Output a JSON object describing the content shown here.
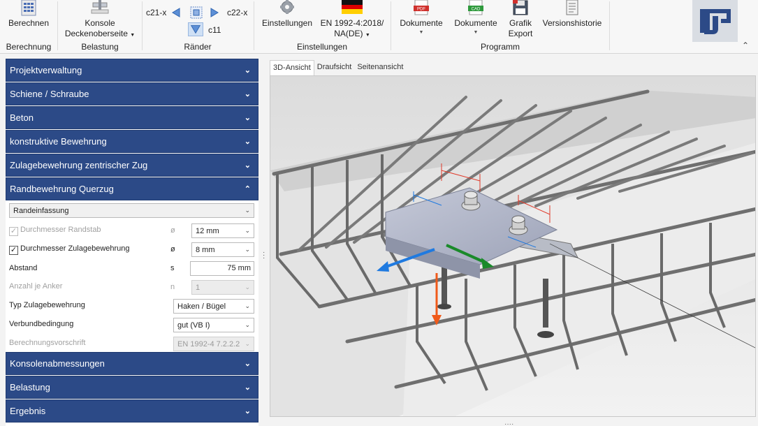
{
  "ribbon": {
    "berechnung": {
      "button": "Berechnen",
      "group": "Berechnung"
    },
    "belastung": {
      "button_line1": "Konsole",
      "button_line2": "Deckenoberseite",
      "group": "Belastung"
    },
    "raender": {
      "c21x": "c21-x",
      "c22x": "c22-x",
      "c11": "c11",
      "group": "Ränder"
    },
    "einstellungen": {
      "settings": "Einstellungen",
      "norm_line1": "EN 1992-4:2018/",
      "norm_line2": "NA(DE)",
      "group": "Einstellungen"
    },
    "programm": {
      "doc_pdf": "Dokumente",
      "doc_cad": "Dokumente",
      "grafik_line1": "Grafik",
      "grafik_line2": "Export",
      "versions": "Versionshistorie",
      "group": "Programm",
      "pdf_tag": "PDF",
      "cad_tag": "CAD"
    }
  },
  "accordion": {
    "projekt": "Projektverwaltung",
    "schiene": "Schiene / Schraube",
    "beton": "Beton",
    "konstruktiv": "konstruktive Bewehrung",
    "zulage_zug": "Zulagebewehrung zentrischer Zug",
    "rand": "Randbewehrung Querzug",
    "konsole": "Konsolenabmessungen",
    "belastung": "Belastung",
    "ergebnis": "Ergebnis"
  },
  "rand_form": {
    "type_select": "Randeinfassung",
    "randstab_label": "Durchmesser Randstab",
    "randstab_sym": "ø",
    "randstab_value": "12 mm",
    "zulage_label": "Durchmesser Zulagebewehrung",
    "zulage_sym": "ø",
    "zulage_value": "8 mm",
    "abstand_label": "Abstand",
    "abstand_sym": "s",
    "abstand_value": "75 mm",
    "anker_label": "Anzahl je Anker",
    "anker_sym": "n",
    "anker_value": "1",
    "typ_label": "Typ Zulagebewehrung",
    "typ_value": "Haken / Bügel",
    "verbund_label": "Verbundbedingung",
    "verbund_value": "gut (VB I)",
    "vorschrift_label": "Berechnungsvorschrift",
    "vorschrift_value": "EN 1992-4 7.2.2.2"
  },
  "view_tabs": [
    "3D-Ansicht",
    "Draufsicht",
    "Seitenansicht"
  ],
  "colors": {
    "accordion": "#2c4a87",
    "arrow_blue": "#1f7ae0",
    "arrow_green": "#1a8a2a",
    "arrow_orange": "#f05a1a",
    "dim_red": "#e03a2a"
  }
}
